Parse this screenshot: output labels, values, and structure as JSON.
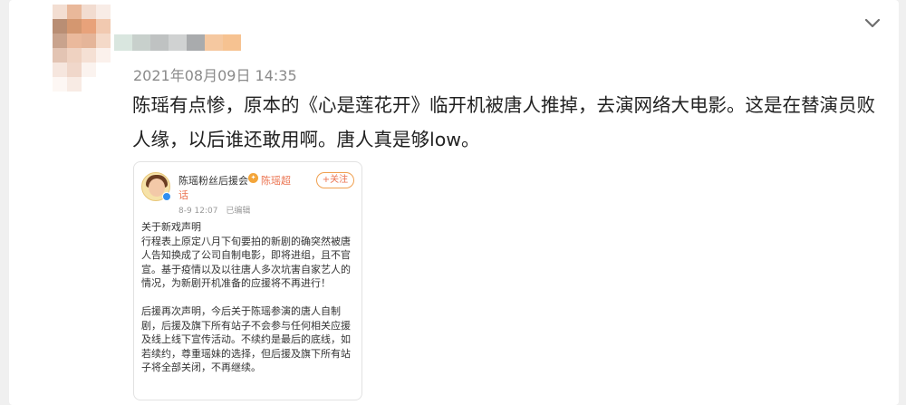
{
  "post": {
    "timestamp": "2021年08月09日 14:35",
    "text": "陈瑶有点惨，原本的《心是莲花开》临开机被唐人推掉，去演网络大电影。这是在替演员败人缘，以后谁还敢用啊。唐人真是够low。",
    "menu_icon": "chevron-down-icon"
  },
  "embed": {
    "author": "陈瑶粉丝后援会",
    "super_topic_part1": "陈瑶超",
    "super_topic_part2": "话",
    "follow_label": "+关注",
    "date": "8-9 12:07",
    "edited": "已编辑",
    "paragraph1": "关于新戏声明\n行程表上原定八月下旬要拍的新剧的确突然被唐人告知换成了公司自制电影，即将进组，且不官宣。基于疫情以及以往唐人多次坑害自家艺人的情况，为新剧开机准备的应援将不再进行！",
    "paragraph2": "后援再次声明，今后关于陈瑶参演的唐人自制剧，后援及旗下所有站子不会参与任何相关应援及线上线下宣传活动。不续约是最后的底线，如若续约，尊重瑶妹的选择，但后援及旗下所有站子将全部关闭，不再继续。"
  },
  "colors": {
    "accent": "#eb7350",
    "verified": "#2f8ff0",
    "timestamp": "#8a8a8a"
  }
}
